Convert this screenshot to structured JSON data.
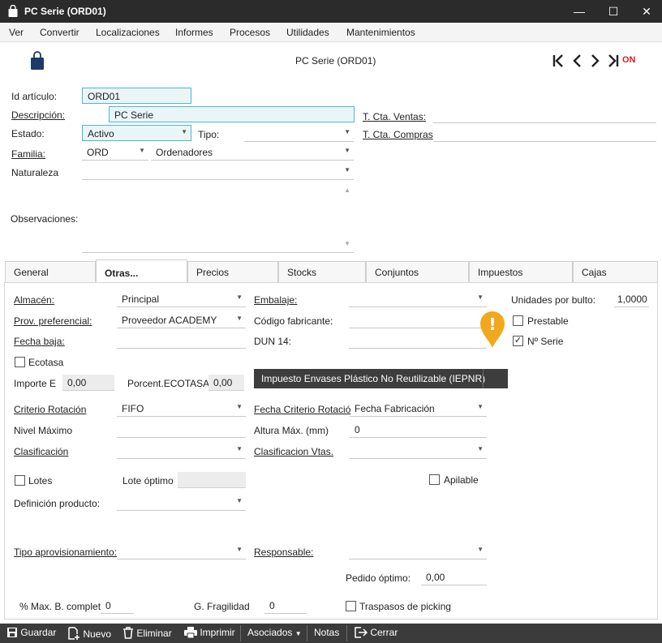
{
  "window": {
    "title": "PC Serie (ORD01)",
    "min": "—",
    "max": "☐",
    "close": "✕"
  },
  "menu": [
    "Ver",
    "Convertir",
    "Localizaciones",
    "Informes",
    "Procesos",
    "Utilidades",
    "Mantenimientos"
  ],
  "header": {
    "record_title": "PC Serie (ORD01)",
    "on_label": "ON",
    "nav": [
      "|<",
      "<",
      ">",
      ">|"
    ]
  },
  "form": {
    "id_label": "Id artículo:",
    "id_value": "ORD01",
    "desc_label": "Descripción:",
    "desc_value": "PC Serie",
    "estado_label": "Estado:",
    "estado_value": "Activo",
    "tipo_label": "Tipo:",
    "tipo_value": "",
    "familia_label": "Familia:",
    "familia_code": "ORD",
    "familia_value": "Ordenadores",
    "naturaleza_label": "Naturaleza",
    "naturaleza_value": "",
    "observaciones_label": "Observaciones:",
    "cta_ventas_label": "T. Cta. Ventas:",
    "cta_ventas_value": "",
    "cta_compras_label": "T. Cta. Compras",
    "cta_compras_value": ""
  },
  "tabs": [
    "General",
    "Otras...",
    "Precios",
    "Stocks",
    "Conjuntos",
    "Impuestos",
    "Cajas"
  ],
  "otras": {
    "almacen_label": "Almacén:",
    "almacen_value": "Principal",
    "embalaje_label": "Embalaje:",
    "embalaje_value": "",
    "unidades_label": "Unidades por bulto:",
    "unidades_value": "1,0000",
    "prov_label": "Prov. preferencial:",
    "prov_value": "Proveedor ACADEMY",
    "codfab_label": "Código fabricante:",
    "codfab_value": "",
    "prestable_label": "Prestable",
    "fechabaja_label": "Fecha baja:",
    "fechabaja_value": "",
    "dun_label": "DUN 14:",
    "dun_value": "",
    "nserie_label": "Nº Serie",
    "nserie_check": "✓",
    "ecotasa_label": "Ecotasa",
    "importe_label": "Importe  E",
    "importe_value": "0,00",
    "porcent_label": "Porcent.ECOTASA:",
    "porcent_value": "0,00",
    "iepnr_button": "Impuesto Envases Plástico No Reutilizable (IEPNR)",
    "crit_rot_label": "Criterio Rotación",
    "crit_rot_value": "FIFO",
    "fecha_crit_label": "Fecha Criterio Rotació",
    "fecha_crit_value": "Fecha Fabricación",
    "nivel_max_label": "Nivel Máximo",
    "nivel_max_value": "",
    "altura_label": "Altura Máx. (mm)",
    "altura_value": "0",
    "clasif_label": "Clasificación",
    "clasif_value": "",
    "clasif_vtas_label": "Clasificacion Vtas.",
    "clasif_vtas_value": "",
    "lotes_label": "Lotes",
    "lote_optimo_label": "Lote óptimo",
    "lote_optimo_value": "",
    "apilable_label": "Apilable",
    "def_prod_label": "Definición producto:",
    "def_prod_value": "",
    "tipo_aprov_label": "Tipo aprovisionamiento:",
    "tipo_aprov_value": "",
    "responsable_label": "Responsable:",
    "responsable_value": "",
    "pedido_label": "Pedido óptimo:",
    "pedido_value": "0,00",
    "max_b_label": "% Max. B. complet",
    "max_b_value": "0",
    "fragilidad_label": "G. Fragilidad",
    "fragilidad_value": "0",
    "traspasos_label": "Traspasos de picking",
    "warning_glyph": "!"
  },
  "toolbar": {
    "guardar": "Guardar",
    "nuevo": "Nuevo",
    "eliminar": "Eliminar",
    "imprimir": "Imprimir",
    "asociados": "Asociados",
    "notas": "Notas",
    "cerrar": "Cerrar"
  },
  "colors": {
    "accent": "#4fb7c9",
    "warning": "#f2a81d",
    "on": "#d32020",
    "titlebar": "#2b2b2b",
    "bottombar": "#3b3b3b"
  }
}
